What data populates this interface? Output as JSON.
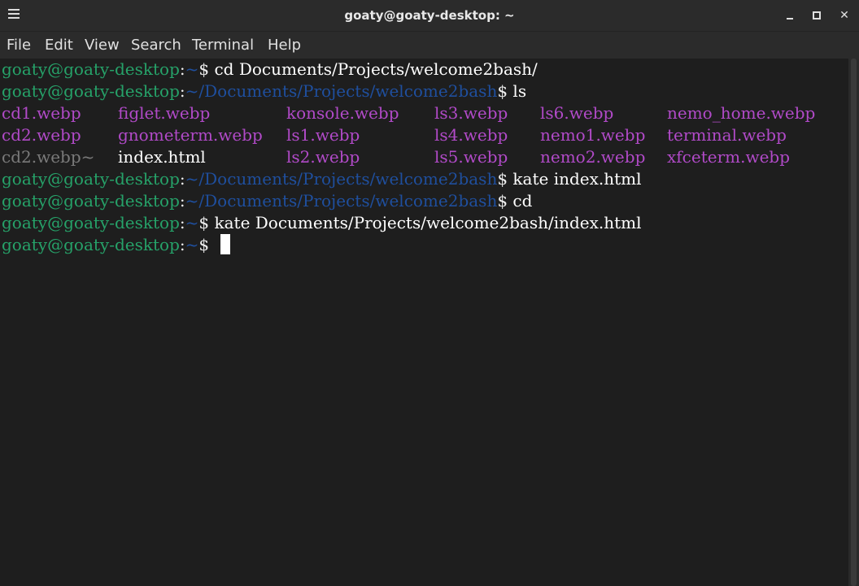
{
  "window": {
    "title": "goaty@goaty-desktop: ~",
    "menu_icon": "hamburger-menu-icon",
    "controls": {
      "minimize": "minimize-icon",
      "maximize": "maximize-icon",
      "close": "close-icon",
      "close_glyph": "✕"
    }
  },
  "menubar": {
    "items": [
      "File",
      "Edit",
      "View",
      "Search",
      "Terminal",
      "Help"
    ]
  },
  "colors": {
    "background": "#1e1e1e",
    "prompt_user": "#26a269",
    "prompt_path": "#1f4f9e",
    "image_file": "#b14ac8",
    "backup_file": "#7a7a7a",
    "text": "#eeeeee"
  },
  "terminal": {
    "prompt_user": "goaty@goaty-desktop",
    "colon": ":",
    "dollar": "$ ",
    "lines": [
      {
        "path": "~",
        "command": "cd Documents/Projects/welcome2bash/"
      },
      {
        "path": "~/Documents/Projects/welcome2bash",
        "command": "ls"
      },
      {
        "path": "~/Documents/Projects/welcome2bash",
        "command": "kate index.html"
      },
      {
        "path": "~/Documents/Projects/welcome2bash",
        "command": "cd"
      },
      {
        "path": "~",
        "command": "kate Documents/Projects/welcome2bash/index.html"
      },
      {
        "path": "~",
        "command": ""
      }
    ],
    "ls_output": [
      [
        "cd1.webp",
        "figlet.webp",
        "konsole.webp",
        "ls3.webp",
        "ls6.webp",
        "nemo_home.webp"
      ],
      [
        "cd2.webp",
        "gnometerm.webp",
        "ls1.webp",
        "ls4.webp",
        "nemo1.webp",
        "terminal.webp"
      ],
      [
        "cd2.webp~",
        "index.html",
        "ls2.webp",
        "ls5.webp",
        "nemo2.webp",
        "xfceterm.webp"
      ]
    ]
  }
}
